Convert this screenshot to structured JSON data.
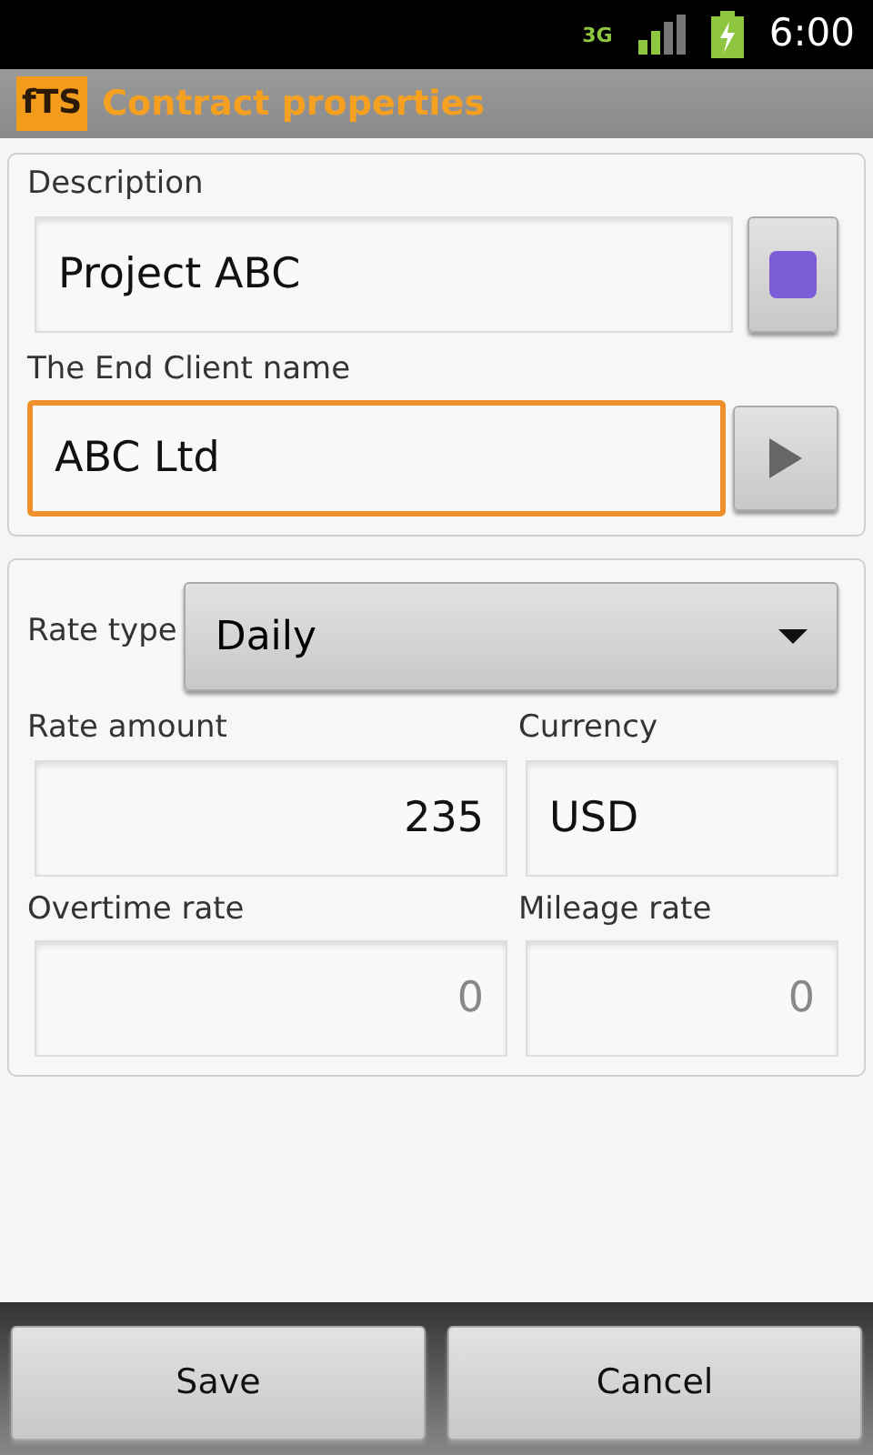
{
  "status_bar": {
    "network": "3G",
    "time": "6:00"
  },
  "title_bar": {
    "logo": "fTS",
    "title": "Contract properties"
  },
  "client_section": {
    "description": {
      "label": "Description",
      "value": "Project ABC",
      "color": "#7b5cd6"
    },
    "client": {
      "label": "The End Client name",
      "value": "ABC Ltd",
      "focused": true
    }
  },
  "rate_section": {
    "rate_type": {
      "label": "Rate type",
      "value": "Daily"
    },
    "fields": [
      {
        "kind": "number",
        "label": "Rate amount",
        "value": "235"
      },
      {
        "kind": "text",
        "label": "Currency",
        "value": "USD"
      },
      {
        "kind": "number",
        "label": "Overtime rate",
        "placeholder": "0"
      },
      {
        "kind": "number",
        "label": "Mileage rate",
        "placeholder": "0"
      }
    ]
  },
  "buttons": [
    "Save",
    "Cancel"
  ]
}
